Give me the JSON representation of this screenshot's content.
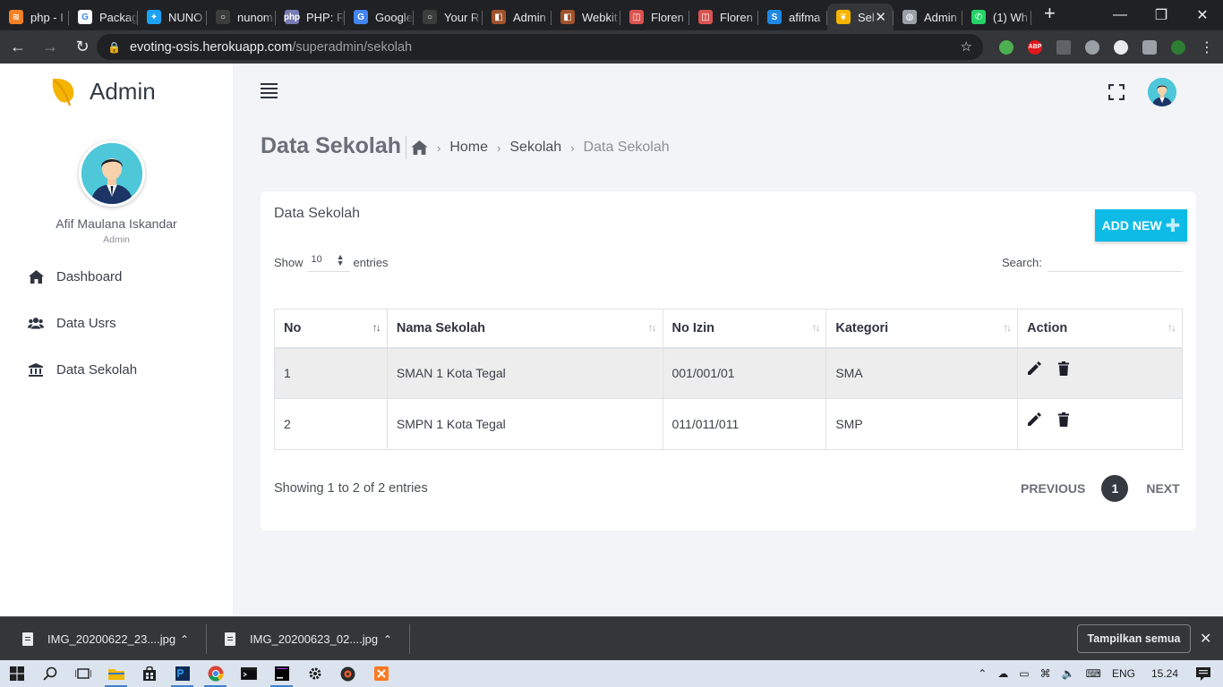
{
  "browser": {
    "tabs": [
      {
        "title": "php - I",
        "color": "#f48024",
        "glyph": "≋"
      },
      {
        "title": "Packag",
        "color": "#ffffff",
        "glyph": "G"
      },
      {
        "title": "NUNO",
        "color": "#1da1f2",
        "glyph": "✦"
      },
      {
        "title": "nunom",
        "color": "#3c3c3c",
        "glyph": "○"
      },
      {
        "title": "PHP: R",
        "color": "#777bb3",
        "glyph": "php"
      },
      {
        "title": "Google",
        "color": "#4285f4",
        "glyph": "G"
      },
      {
        "title": "Your R",
        "color": "#3c3c3c",
        "glyph": "○"
      },
      {
        "title": "Admin",
        "color": "#a0522d",
        "glyph": "◧"
      },
      {
        "title": "Webkit",
        "color": "#a0522d",
        "glyph": "◧"
      },
      {
        "title": "Floren",
        "color": "#d9534f",
        "glyph": "◫"
      },
      {
        "title": "Floren",
        "color": "#d9534f",
        "glyph": "◫"
      },
      {
        "title": "afifma",
        "color": "#1e88e5",
        "glyph": "S"
      },
      {
        "title": "Sel",
        "color": "#f5b400",
        "glyph": "❦",
        "active": true
      },
      {
        "title": "Admin",
        "color": "#9aa0a6",
        "glyph": "◍"
      },
      {
        "title": "(1) Wh",
        "color": "#25d366",
        "glyph": "✆"
      }
    ],
    "url_host": "evoting-osis.herokuapp.com",
    "url_path": "/superadmin/sekolah"
  },
  "sidebar": {
    "brand": "Admin",
    "user_name": "Afif Maulana Iskandar",
    "user_role": "Admin",
    "menu": [
      {
        "label": "Dashboard",
        "icon": "home-icon"
      },
      {
        "label": "Data Usrs",
        "icon": "users-icon"
      },
      {
        "label": "Data Sekolah",
        "icon": "bank-icon"
      }
    ]
  },
  "header": {
    "page_title": "Data Sekolah",
    "breadcrumb": [
      "Home",
      "Sekolah",
      "Data Sekolah"
    ]
  },
  "card": {
    "title": "Data Sekolah",
    "add_label": "ADD NEW",
    "show_label": "Show",
    "entries_value": "10",
    "entries_label": "entries",
    "search_label": "Search:",
    "columns": [
      "No",
      "Nama Sekolah",
      "No Izin",
      "Kategori",
      "Action"
    ],
    "rows": [
      {
        "no": "1",
        "nama": "SMAN 1 Kota Tegal",
        "izin": "001/001/01",
        "kategori": "SMA"
      },
      {
        "no": "2",
        "nama": "SMPN 1 Kota Tegal",
        "izin": "011/011/011",
        "kategori": "SMP"
      }
    ],
    "info": "Showing 1 to 2 of 2 entries",
    "prev": "PREVIOUS",
    "page": "1",
    "next": "NEXT"
  },
  "downloads": {
    "items": [
      "IMG_20200622_23....jpg",
      "IMG_20200623_02....jpg"
    ],
    "show_all": "Tampilkan semua"
  },
  "taskbar": {
    "lang": "ENG",
    "time": "15.24"
  }
}
